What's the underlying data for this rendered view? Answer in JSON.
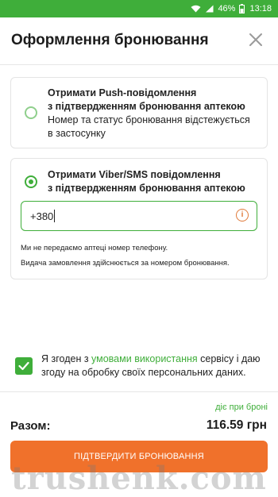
{
  "status_bar": {
    "battery": "46%",
    "time": "13:18"
  },
  "header": {
    "title": "Оформлення бронювання",
    "close_icon": "close-icon"
  },
  "options": {
    "push": {
      "title_line1": "Отримати Push-повідомлення",
      "title_line2": "з підтвердженням бронювання аптекою",
      "description": " Номер та статус бронювання відстежується в застосунку",
      "selected": false
    },
    "viber_sms": {
      "title_line1": "Отримати Viber/SMS повідомлення",
      "title_line2": "з підтвердженням бронювання аптекою",
      "selected": true,
      "phone_value": "+380",
      "info_icon": "info-icon",
      "note1": "Ми не передаємо аптеці номер телефону.",
      "note2": "Видача замовлення здійснюється за номером бронювання."
    }
  },
  "consent": {
    "checked": true,
    "text_before": "Я згоден з ",
    "link_text": "умовами використання",
    "text_after": " сервісу і даю згоду на обробку своїх персональних даних."
  },
  "summary": {
    "validity_link": "діє при броні",
    "total_label": "Разом:",
    "total_value": "116.59 грн"
  },
  "confirm_button": "ПІДТВЕРДИТИ БРОНЮВАННЯ",
  "watermark": "trushenk.com",
  "colors": {
    "accent_green": "#3fae3a",
    "button_orange": "#f0712b",
    "info_orange": "#e07a3a"
  }
}
